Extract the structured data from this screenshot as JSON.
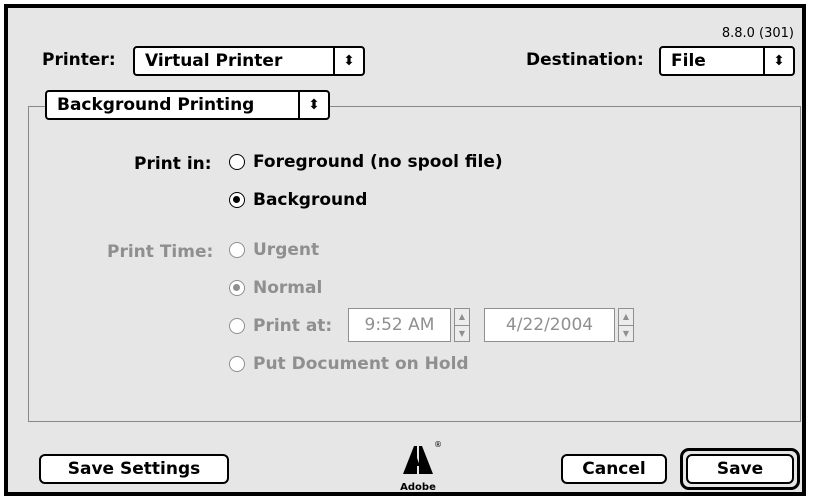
{
  "version": "8.8.0 (301)",
  "printer": {
    "label": "Printer:",
    "value": "Virtual Printer"
  },
  "destination": {
    "label": "Destination:",
    "value": "File"
  },
  "panel": {
    "value": "Background Printing"
  },
  "print_in": {
    "label": "Print in:",
    "options": [
      "Foreground (no spool file)",
      "Background"
    ],
    "selected": "Background"
  },
  "print_time": {
    "label": "Print Time:",
    "options": [
      "Urgent",
      "Normal",
      "Print at:",
      "Put Document on Hold"
    ],
    "selected": "Normal",
    "time": "9:52 AM",
    "date": "4/22/2004"
  },
  "logo": {
    "text": "Adobe",
    "registered": "®"
  },
  "buttons": {
    "save_settings": "Save Settings",
    "cancel": "Cancel",
    "save": "Save"
  },
  "icons": {
    "popup": "up-down-arrows-icon",
    "stepper": "stepper-icon",
    "logo": "adobe-logo-icon"
  }
}
